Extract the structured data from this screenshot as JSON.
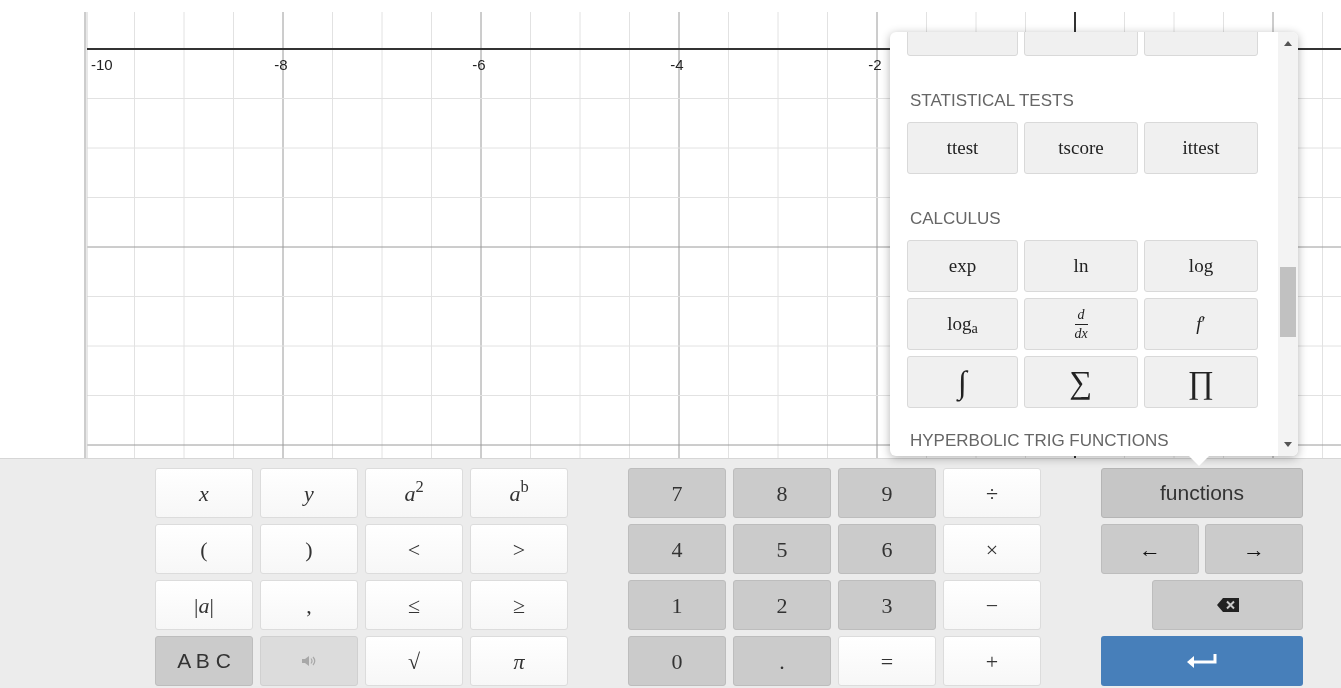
{
  "graph": {
    "x_labels": [
      "-10",
      "-8",
      "-6",
      "-4",
      "-2"
    ]
  },
  "functions_menu": {
    "sections": [
      {
        "heading": "STATISTICAL TESTS",
        "buttons": [
          {
            "kind": "text",
            "label": "ttest"
          },
          {
            "kind": "text",
            "label": "tscore"
          },
          {
            "kind": "text",
            "label": "ittest"
          }
        ]
      },
      {
        "heading": "CALCULUS",
        "buttons": [
          {
            "kind": "text",
            "label": "exp"
          },
          {
            "kind": "text",
            "label": "ln"
          },
          {
            "kind": "text",
            "label": "log"
          },
          {
            "kind": "text",
            "label": "log$_{a}$"
          },
          {
            "kind": "fraction",
            "numerator": "d",
            "denominator": "dx"
          },
          {
            "kind": "text",
            "label": "*f*′"
          },
          {
            "kind": "symbol",
            "label": "∫"
          },
          {
            "kind": "symbol",
            "label": "∑"
          },
          {
            "kind": "symbol",
            "label": "∏"
          }
        ]
      },
      {
        "heading": "HYPERBOLIC TRIG FUNCTIONS"
      }
    ]
  },
  "keypad": {
    "groups": [
      {
        "keys": [
          {
            "kind": "math",
            "shaded": false,
            "label": "x",
            "italic": true
          },
          {
            "kind": "math",
            "shaded": false,
            "label": "y",
            "italic": true
          },
          {
            "kind": "math",
            "shaded": false,
            "label": "*a*$^{2}$",
            "italic": false
          },
          {
            "kind": "math",
            "shaded": false,
            "label": "*a*$^{b}$",
            "italic": false
          },
          {
            "kind": "math",
            "shaded": false,
            "label": "(",
            "italic": false
          },
          {
            "kind": "math",
            "shaded": false,
            "label": ")",
            "italic": false
          },
          {
            "kind": "math",
            "shaded": false,
            "label": "<",
            "italic": false
          },
          {
            "kind": "math",
            "shaded": false,
            "label": ">",
            "italic": false
          },
          {
            "kind": "math",
            "shaded": false,
            "label": "|*a*|",
            "italic": false
          },
          {
            "kind": "math",
            "shaded": false,
            "label": ",",
            "italic": false
          },
          {
            "kind": "math",
            "shaded": false,
            "label": "≤",
            "italic": false
          },
          {
            "kind": "math",
            "shaded": false,
            "label": "≥",
            "italic": false
          },
          {
            "kind": "text",
            "shaded": true,
            "label": "A B C"
          },
          {
            "kind": "speaker",
            "disabled": true
          },
          {
            "kind": "math",
            "shaded": false,
            "label": "√"
          },
          {
            "kind": "math",
            "shaded": false,
            "label": "π",
            "italic": true
          }
        ]
      },
      {
        "keys": [
          {
            "kind": "math",
            "shaded": true,
            "label": "7",
            "italic": false
          },
          {
            "kind": "math",
            "shaded": true,
            "label": "8",
            "italic": false
          },
          {
            "kind": "math",
            "shaded": true,
            "label": "9",
            "italic": false
          },
          {
            "kind": "math",
            "shaded": false,
            "label": "÷",
            "italic": false
          },
          {
            "kind": "math",
            "shaded": true,
            "label": "4",
            "italic": false
          },
          {
            "kind": "math",
            "shaded": true,
            "label": "5",
            "italic": false
          },
          {
            "kind": "math",
            "shaded": true,
            "label": "6",
            "italic": false
          },
          {
            "kind": "math",
            "shaded": false,
            "label": "×",
            "italic": false
          },
          {
            "kind": "math",
            "shaded": true,
            "label": "1",
            "italic": false
          },
          {
            "kind": "math",
            "shaded": true,
            "label": "2",
            "italic": false
          },
          {
            "kind": "math",
            "shaded": true,
            "label": "3",
            "italic": false
          },
          {
            "kind": "math",
            "shaded": false,
            "label": "−",
            "italic": false
          },
          {
            "kind": "math",
            "shaded": true,
            "label": "0",
            "italic": false
          },
          {
            "kind": "math",
            "shaded": true,
            "label": ".",
            "italic": false
          },
          {
            "kind": "math",
            "shaded": false,
            "label": "=",
            "italic": false
          },
          {
            "kind": "math",
            "shaded": false,
            "label": "+",
            "italic": false
          }
        ]
      }
    ],
    "functions_button": {
      "label": "functions",
      "expanded": true
    },
    "left_arrow": "←",
    "right_arrow": "→"
  }
}
